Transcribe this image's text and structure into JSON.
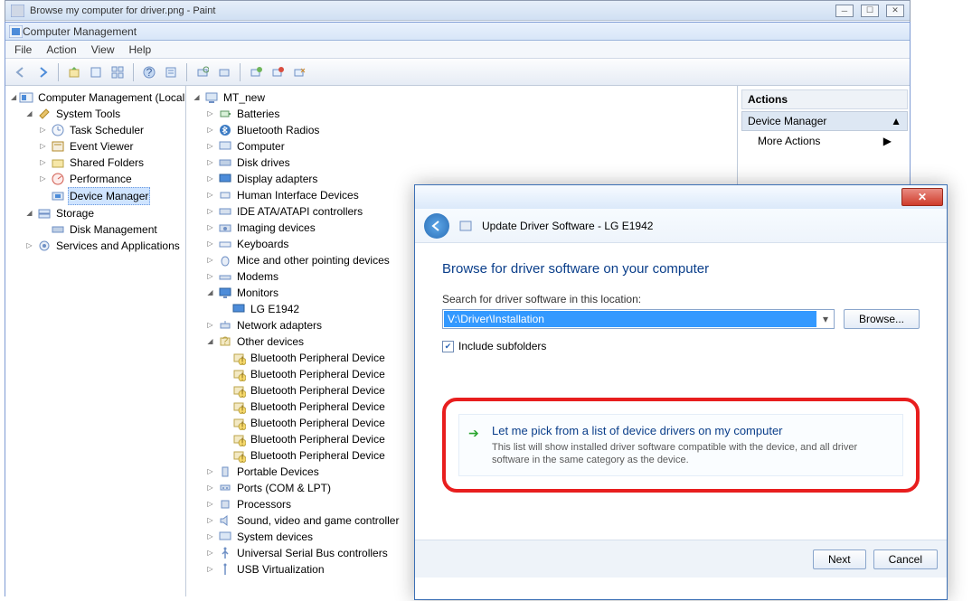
{
  "outer": {
    "title": "Browse my computer for driver.png - Paint"
  },
  "mmc": {
    "title": "Computer Management",
    "menu": [
      "File",
      "Action",
      "View",
      "Help"
    ]
  },
  "left_tree": {
    "root": "Computer Management (Local",
    "system_tools": "System Tools",
    "task_scheduler": "Task Scheduler",
    "event_viewer": "Event Viewer",
    "shared_folders": "Shared Folders",
    "performance": "Performance",
    "device_manager": "Device Manager",
    "storage": "Storage",
    "disk_management": "Disk Management",
    "services": "Services and Applications"
  },
  "devices": {
    "root": "MT_new",
    "batteries": "Batteries",
    "bluetooth": "Bluetooth Radios",
    "computer": "Computer",
    "disk": "Disk drives",
    "display": "Display adapters",
    "hid": "Human Interface Devices",
    "ide": "IDE ATA/ATAPI controllers",
    "imaging": "Imaging devices",
    "keyboards": "Keyboards",
    "mice": "Mice and other pointing devices",
    "modems": "Modems",
    "monitors": "Monitors",
    "lg": "LG E1942",
    "network": "Network adapters",
    "other": "Other devices",
    "bpd": "Bluetooth Peripheral Device",
    "portable": "Portable Devices",
    "ports": "Ports (COM & LPT)",
    "processors": "Processors",
    "sound": "Sound, video and game controller",
    "system": "System devices",
    "usb": "Universal Serial Bus controllers",
    "usbvirt": "USB Virtualization"
  },
  "actions": {
    "header": "Actions",
    "sub": "Device Manager",
    "more": "More Actions"
  },
  "dialog": {
    "title": "Update Driver Software - LG E1942",
    "heading": "Browse for driver software on your computer",
    "search_label": "Search for driver software in this location:",
    "path": "V:\\Driver\\Installation",
    "browse": "Browse...",
    "include": "Include subfolders",
    "pick_title": "Let me pick from a list of device drivers on my computer",
    "pick_desc": "This list will show installed driver software compatible with the device, and all driver software in the same category as the device.",
    "next": "Next",
    "cancel": "Cancel"
  }
}
